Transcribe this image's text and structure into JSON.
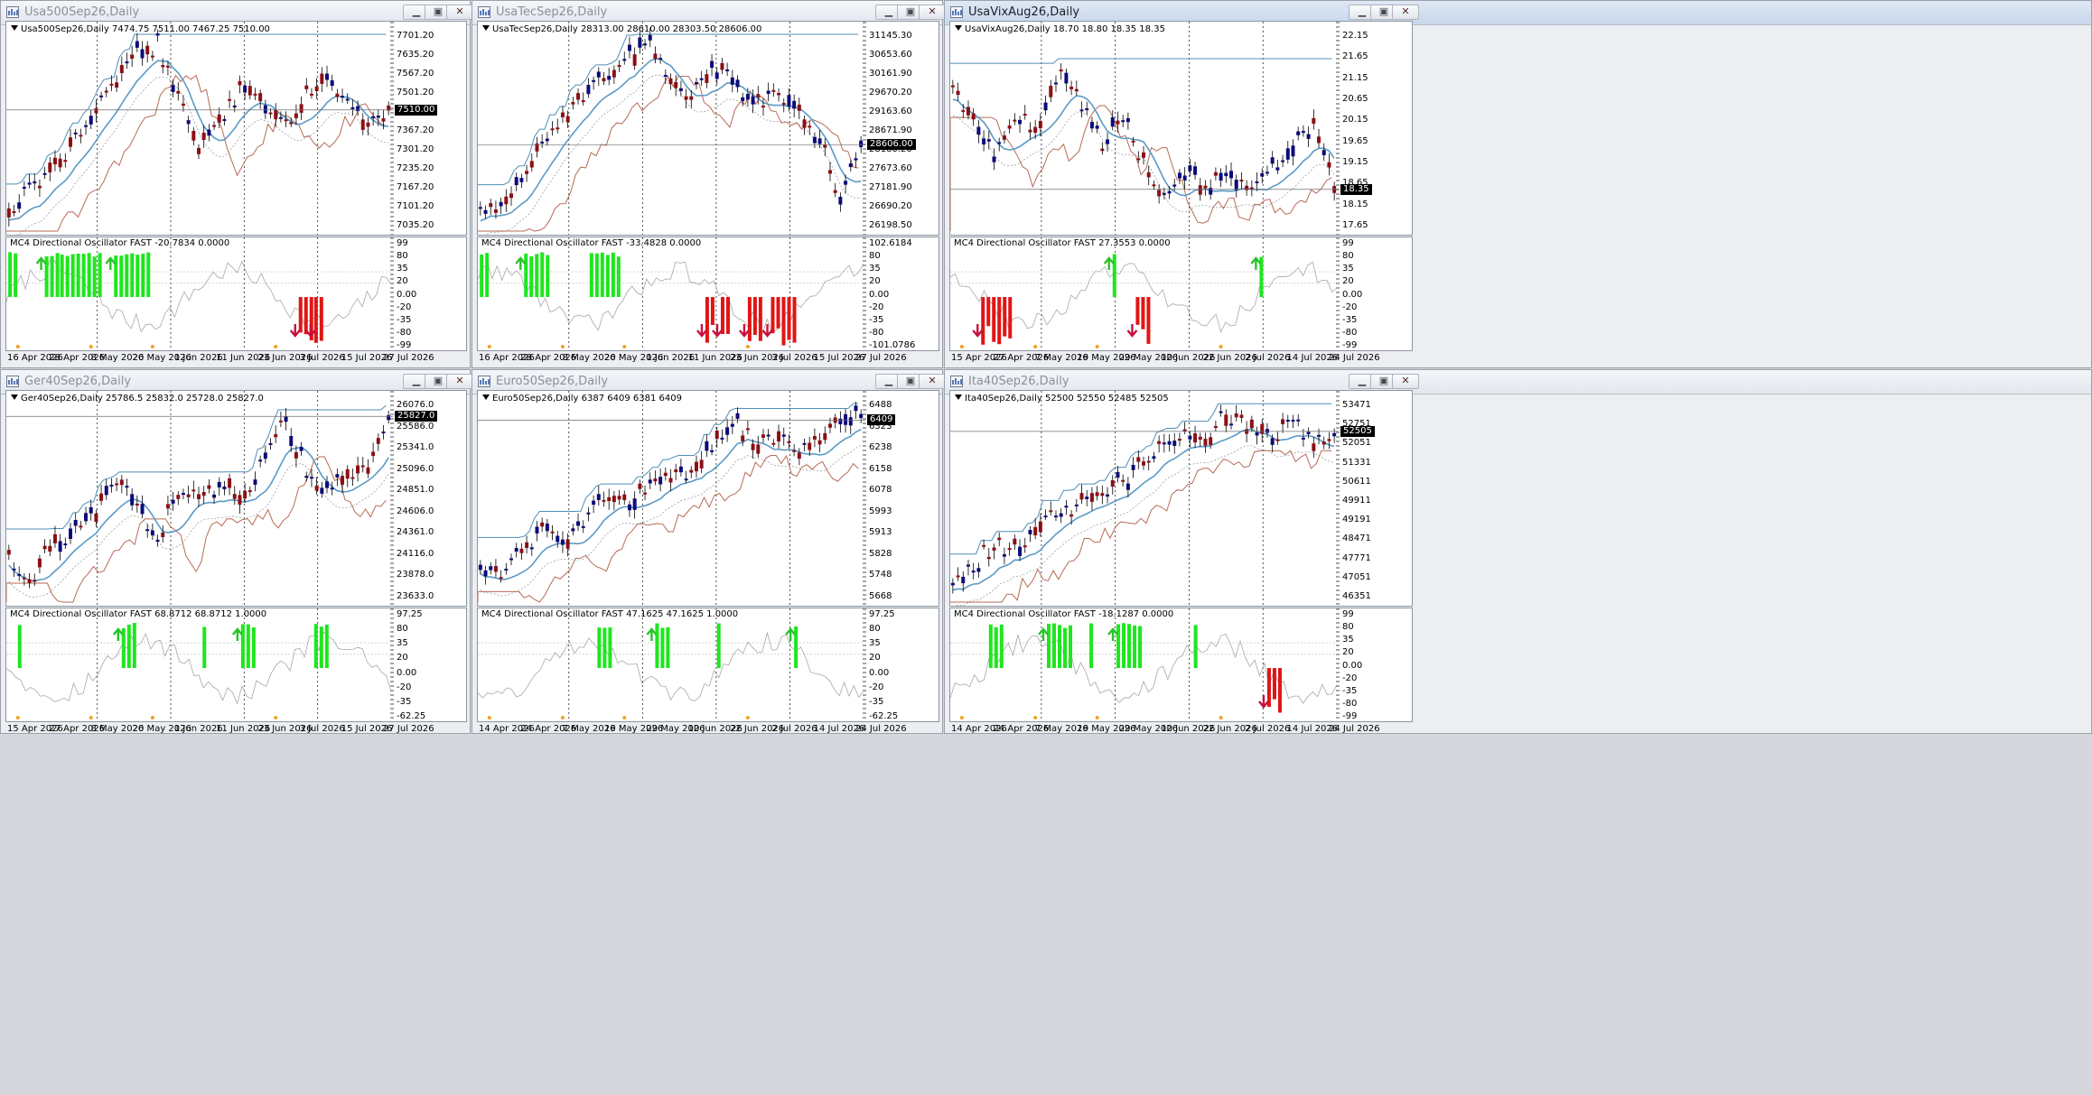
{
  "colors": {
    "up": "#0b0b7a",
    "down": "#8c0f14",
    "ma": "#5b9ac6",
    "trail": "#b76a56",
    "channel": "#4f8fb5",
    "envelope": "#9aa0a8",
    "osc_line": "#a7a7a7",
    "green": "#1ee61e",
    "red": "#e01515",
    "arrow_up": "#28c328",
    "arrow_down": "#c8103c",
    "dot": "#f2a023"
  },
  "windows": [
    {
      "id": "spx",
      "title": "Usa500Sep26,Daily",
      "active": false,
      "header": "Usa500Sep26,Daily  7474.75 7511.00 7467.25 7510.00",
      "price_ticks": [
        "7701.20",
        "7635.20",
        "7567.20",
        "7501.20",
        "7435.20",
        "7367.20",
        "7301.20",
        "7235.20",
        "7167.20",
        "7101.20",
        "7035.20"
      ],
      "last_price": "7510.00",
      "osc_header": "MC4 Directional Oscillator FAST -20.7834 0.0000",
      "osc_ticks": [
        "99",
        "80",
        "35",
        "20",
        "0.00",
        "-20",
        "-35",
        "-80",
        "-99"
      ],
      "dates": [
        "16 Apr 2026",
        "28 Apr 2026",
        "8 May 2026",
        "20 May 2026",
        "1 Jun 2026",
        "11 Jun 2026",
        "23 Jun 2026",
        "3 Jul 2026",
        "15 Jul 2026",
        "27 Jul 2026"
      ]
    },
    {
      "id": "ndx",
      "title": "UsaTecSep26,Daily",
      "active": false,
      "header": "UsaTecSep26,Daily  28313.00 28610.00 28303.50 28606.00",
      "price_ticks": [
        "31145.30",
        "30653.60",
        "30161.90",
        "29670.20",
        "29163.60",
        "28671.90",
        "28180.20",
        "27673.60",
        "27181.90",
        "26690.20",
        "26198.50"
      ],
      "last_price": "28606.00",
      "osc_header": "MC4 Directional Oscillator FAST -33.4828 0.0000",
      "osc_ticks": [
        "102.6184",
        "80",
        "35",
        "20",
        "0.00",
        "-20",
        "-35",
        "-80",
        "-101.0786"
      ],
      "dates": [
        "16 Apr 2026",
        "28 Apr 2026",
        "8 May 2026",
        "20 May 2026",
        "1 Jun 2026",
        "11 Jun 2026",
        "23 Jun 2026",
        "3 Jul 2026",
        "15 Jul 2026",
        "27 Jul 2026"
      ]
    },
    {
      "id": "vix",
      "title": "UsaVixAug26,Daily",
      "active": true,
      "header": "UsaVixAug26,Daily  18.70 18.80 18.35 18.35",
      "price_ticks": [
        "22.15",
        "21.65",
        "21.15",
        "20.65",
        "20.15",
        "19.65",
        "19.15",
        "18.65",
        "18.15",
        "17.65"
      ],
      "last_price": "18.35",
      "osc_header": "MC4 Directional Oscillator FAST 27.3553 0.0000",
      "osc_ticks": [
        "99",
        "80",
        "35",
        "20",
        "0.00",
        "-20",
        "-35",
        "-80",
        "-99"
      ],
      "dates": [
        "15 Apr 2026",
        "27 Apr 2026",
        "7 May 2026",
        "19 May 2026",
        "29 May 2026",
        "10 Jun 2026",
        "22 Jun 2026",
        "2 Jul 2026",
        "14 Jul 2026",
        "24 Jul 2026"
      ]
    },
    {
      "id": "dax",
      "title": "Ger40Sep26,Daily",
      "active": false,
      "header": "Ger40Sep26,Daily  25786.5 25832.0 25728.0 25827.0",
      "price_ticks": [
        "26076.0",
        "25586.0",
        "25341.0",
        "25096.0",
        "24851.0",
        "24606.0",
        "24361.0",
        "24116.0",
        "23878.0",
        "23633.0"
      ],
      "last_price": "25827.0",
      "osc_header": "MC4 Directional Oscillator FAST 68.8712 68.8712 1.0000",
      "osc_ticks": [
        "97.25",
        "80",
        "35",
        "20",
        "0.00",
        "-20",
        "-35",
        "-62.25"
      ],
      "dates": [
        "15 Apr 2026",
        "27 Apr 2026",
        "8 May 2026",
        "20 May 2026",
        "1 Jun 2026",
        "11 Jun 2026",
        "23 Jun 2026",
        "3 Jul 2026",
        "15 Jul 2026",
        "27 Jul 2026"
      ]
    },
    {
      "id": "sx5e",
      "title": "Euro50Sep26,Daily",
      "active": false,
      "header": "Euro50Sep26,Daily  6387 6409 6381 6409",
      "price_ticks": [
        "6488",
        "6323",
        "6238",
        "6158",
        "6078",
        "5993",
        "5913",
        "5828",
        "5748",
        "5668"
      ],
      "last_price": "6409",
      "osc_header": "MC4 Directional Oscillator FAST 47.1625 47.1625 1.0000",
      "osc_ticks": [
        "97.25",
        "80",
        "35",
        "20",
        "0.00",
        "-20",
        "-35",
        "-62.25"
      ],
      "dates": [
        "14 Apr 2026",
        "24 Apr 2026",
        "7 May 2026",
        "19 May 2026",
        "29 May 2026",
        "10 Jun 2026",
        "22 Jun 2026",
        "2 Jul 2026",
        "14 Jul 2026",
        "24 Jul 2026"
      ]
    },
    {
      "id": "ftse",
      "title": "Ita40Sep26,Daily",
      "active": false,
      "header": "Ita40Sep26,Daily  52500 52550 52485 52505",
      "price_ticks": [
        "53471",
        "52751",
        "52051",
        "51331",
        "50611",
        "49911",
        "49191",
        "48471",
        "47771",
        "47051",
        "46351"
      ],
      "last_price": "52505",
      "osc_header": "MC4 Directional Oscillator FAST -18.1287 0.0000",
      "osc_ticks": [
        "99",
        "80",
        "35",
        "20",
        "0.00",
        "-20",
        "-35",
        "-80",
        "-99"
      ],
      "dates": [
        "14 Apr 2026",
        "24 Apr 2026",
        "7 May 2026",
        "19 May 2026",
        "29 May 2026",
        "10 Jun 2026",
        "22 Jun 2026",
        "2 Jul 2026",
        "14 Jul 2026",
        "24 Jul 2026"
      ]
    }
  ]
}
